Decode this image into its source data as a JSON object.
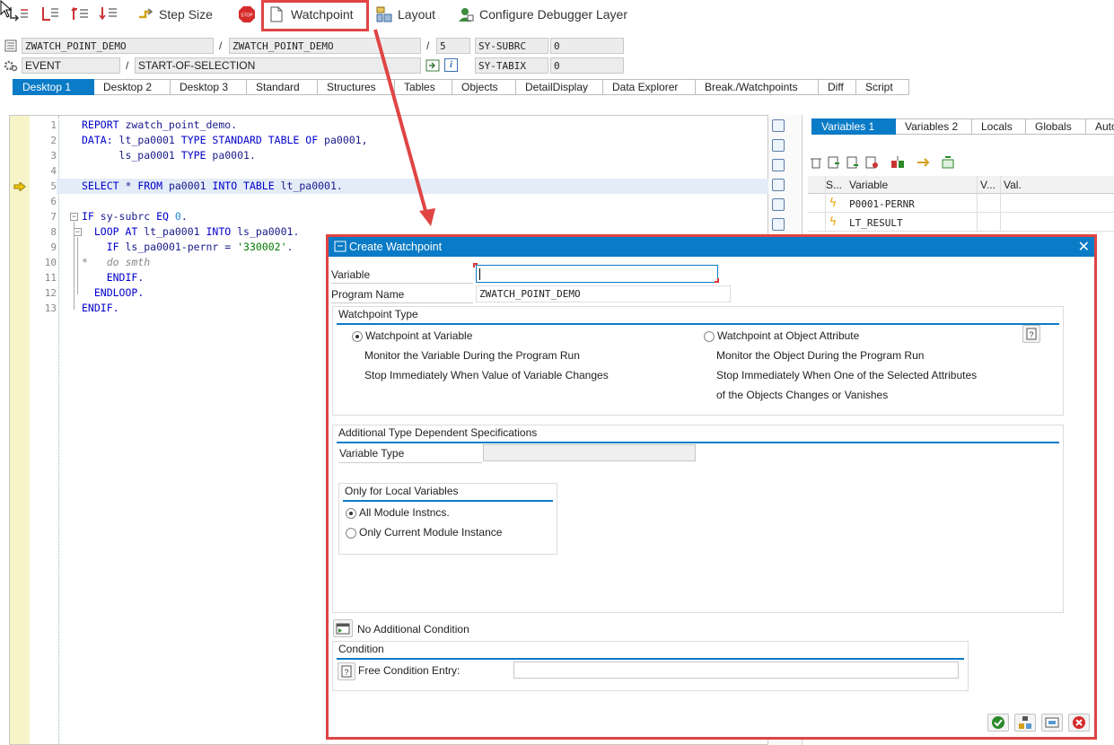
{
  "toolbar": {
    "step_size": "Step Size",
    "watchpoint": "Watchpoint",
    "layout": "Layout",
    "configure": "Configure Debugger Layer",
    "stop_text": "STOP"
  },
  "status": {
    "program1": "ZWATCH_POINT_DEMO",
    "program2": "ZWATCH_POINT_DEMO",
    "line": "5",
    "sysubrc_label": "SY-SUBRC",
    "sysubrc_value": "0",
    "event": "EVENT",
    "event_name": "START-OF-SELECTION",
    "sytabix_label": "SY-TABIX",
    "sytabix_value": "0",
    "info_icon": "i"
  },
  "tabs": [
    "Desktop 1",
    "Desktop 2",
    "Desktop 3",
    "Standard",
    "Structures",
    "Tables",
    "Objects",
    "DetailDisplay",
    "Data Explorer",
    "Break./Watchpoints",
    "Diff",
    "Script"
  ],
  "editor": {
    "lines": [
      "1",
      "2",
      "3",
      "4",
      "5",
      "6",
      "7",
      "8",
      "9",
      "10",
      "11",
      "12",
      "13"
    ]
  },
  "variables": {
    "tabs": [
      "Variables 1",
      "Variables 2",
      "Locals",
      "Globals",
      "Auto"
    ],
    "col_s": "S...",
    "col_variable": "Variable",
    "col_v": "V...",
    "col_val": "Val.",
    "rows": [
      "P0001-PERNR",
      "LT_RESULT"
    ]
  },
  "dialog": {
    "title": "Create Watchpoint",
    "variable_label": "Variable",
    "variable_value": "",
    "program_label": "Program Name",
    "program_value": "ZWATCH_POINT_DEMO",
    "wp_type_title": "Watchpoint Type",
    "opt_variable": "Watchpoint at Variable",
    "opt_variable_d1": "Monitor the Variable During the Program Run",
    "opt_variable_d2": "Stop Immediately When Value of Variable Changes",
    "opt_object": "Watchpoint at Object Attribute",
    "opt_object_d1": "Monitor the Object During the Program Run",
    "opt_object_d2": "Stop Immediately When One of the Selected Attributes",
    "opt_object_d3": "of the Objects Changes or Vanishes",
    "add_title": "Additional Type Dependent Specifications",
    "var_type_label": "Variable Type",
    "local_title": "Only for Local Variables",
    "opt_all": "All Module Instncs.",
    "opt_current": "Only Current Module Instance",
    "no_condition": "No Additional Condition",
    "condition_title": "Condition",
    "free_condition": "Free Condition Entry:"
  },
  "colors": {
    "accent": "#0a7bc6",
    "highlight": "#e04444"
  }
}
